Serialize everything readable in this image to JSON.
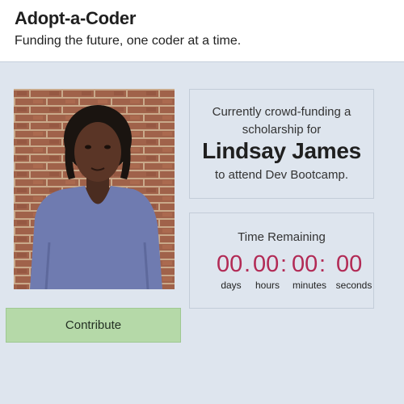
{
  "header": {
    "title": "Adopt-a-Coder",
    "subtitle": "Funding the future, one coder at a time."
  },
  "profile": {
    "photo_icon": "person-portrait-photo"
  },
  "info": {
    "line1": "Currently crowd-funding a",
    "line2": "scholarship for",
    "name": "Lindsay James",
    "line3": "to attend Dev Bootcamp."
  },
  "timer": {
    "label": "Time Remaining",
    "days": "00",
    "hours": "00",
    "minutes": "00",
    "seconds": "00",
    "sep1": ".",
    "sep2": ":",
    "sep3": ":",
    "unit_days": "days",
    "unit_hours": "hours",
    "unit_minutes": "minutes",
    "unit_seconds": "seconds",
    "digit_color": "#b22a55"
  },
  "actions": {
    "contribute_label": "Contribute",
    "contribute_color": "#b5d9a8"
  }
}
